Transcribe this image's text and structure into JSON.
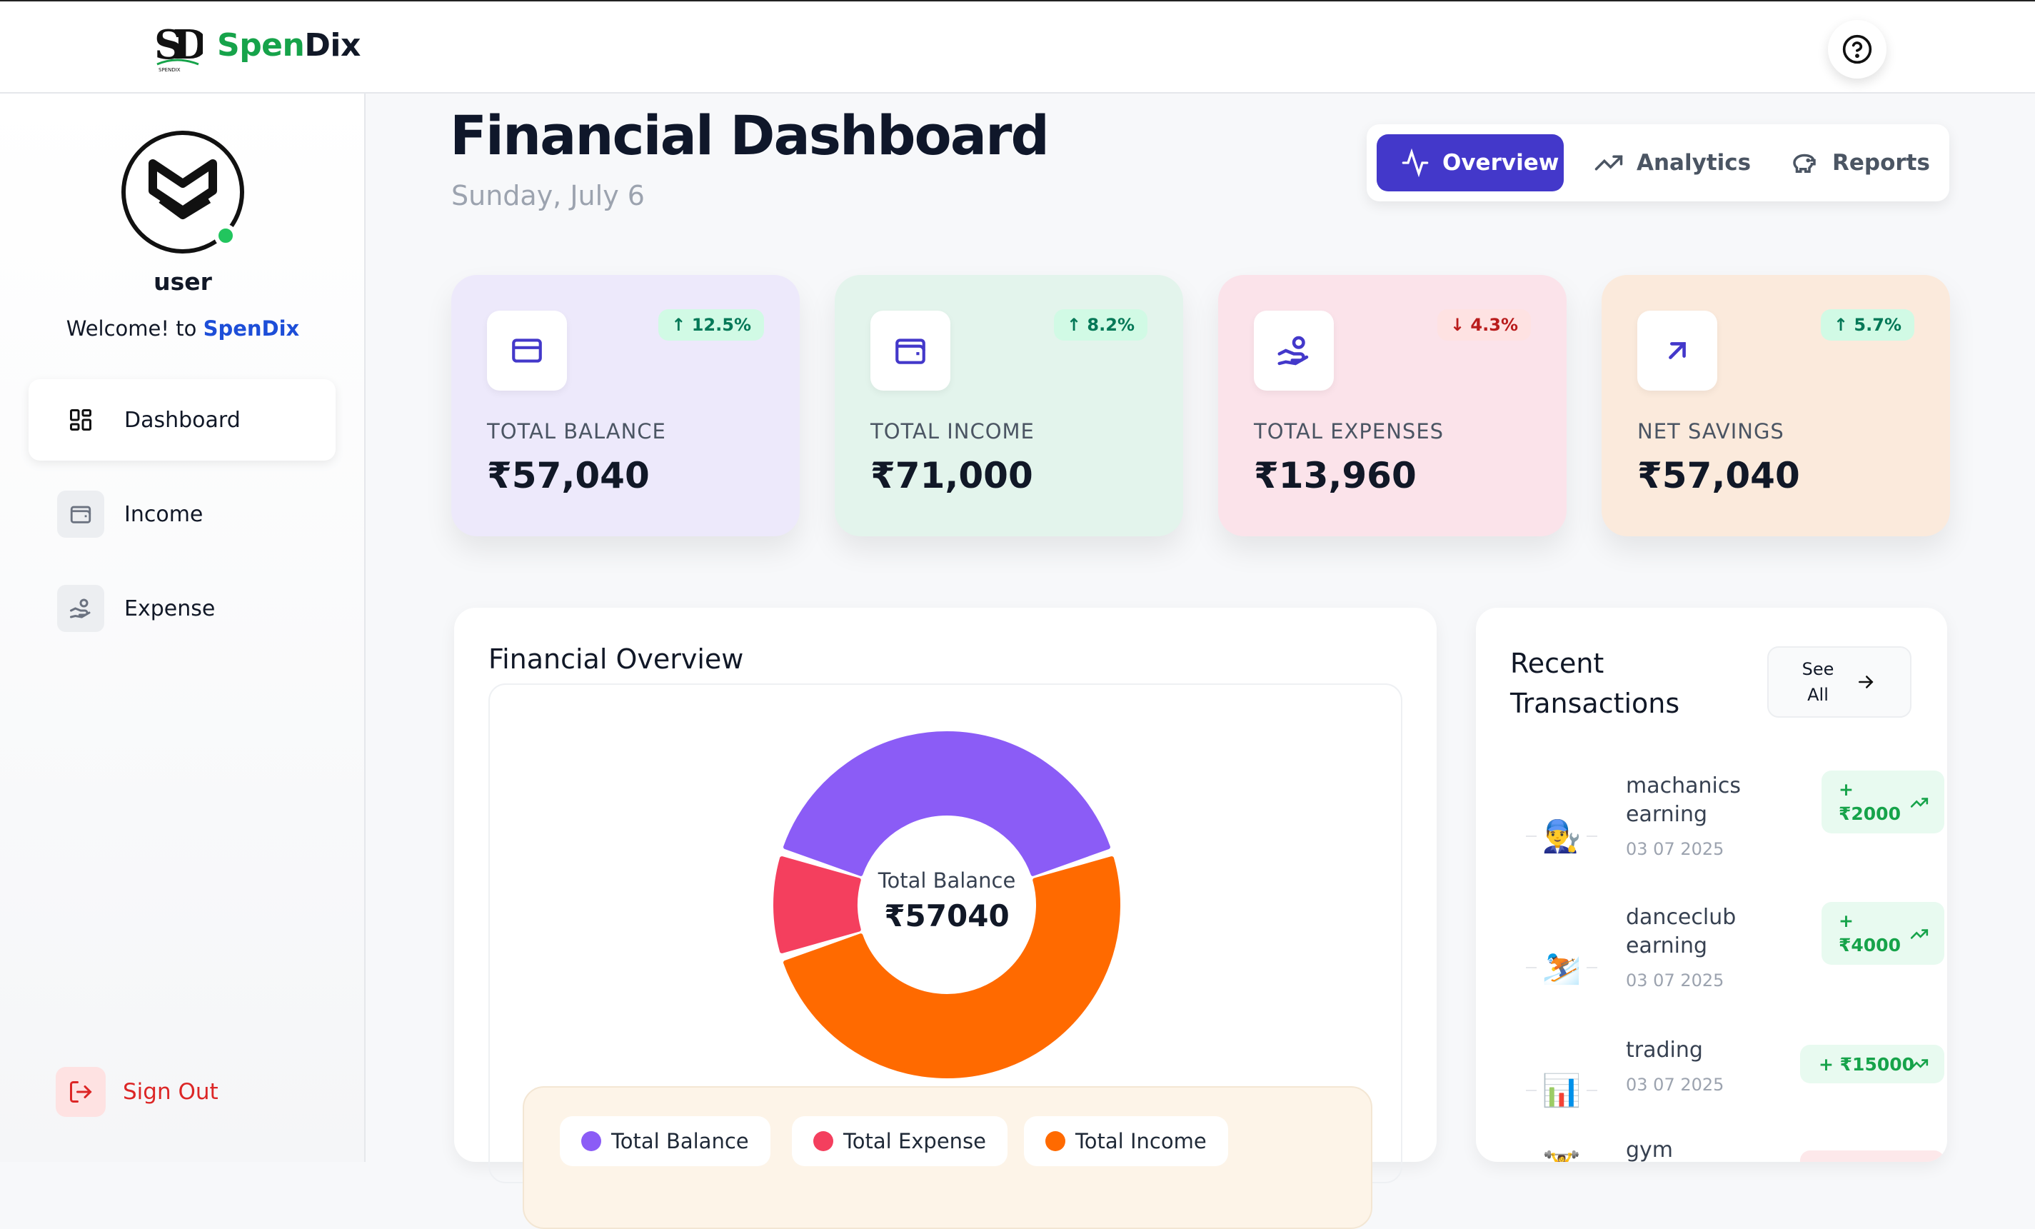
{
  "app": {
    "brand_spen": "Spen",
    "brand_dix": "Dix",
    "logo_sub": "SPENDIX"
  },
  "sidebar": {
    "username": "user",
    "welcome_prefix": "Welcome! to ",
    "welcome_brand": "SpenDix",
    "items": [
      {
        "label": "Dashboard",
        "icon": "grid-icon",
        "active": true
      },
      {
        "label": "Income",
        "icon": "wallet-icon",
        "active": false
      },
      {
        "label": "Expense",
        "icon": "hand-coins-icon",
        "active": false
      }
    ],
    "signout_label": "Sign Out"
  },
  "header": {
    "title": "Financial Dashboard",
    "date": "Sunday, July 6",
    "tabs": [
      {
        "label": "Overview",
        "icon": "activity-icon",
        "active": true
      },
      {
        "label": "Analytics",
        "icon": "trending-up-icon",
        "active": false
      },
      {
        "label": "Reports",
        "icon": "piggy-bank-icon",
        "active": false
      }
    ]
  },
  "cards": [
    {
      "label": "TOTAL BALANCE",
      "value": "₹57,040",
      "change": "↑ 12.5%",
      "trend": "up",
      "bg": "#ede9fb",
      "icon": "credit-card-icon"
    },
    {
      "label": "TOTAL INCOME",
      "value": "₹71,000",
      "change": "↑ 8.2%",
      "trend": "up",
      "bg": "#e3f4ec",
      "icon": "wallet-icon"
    },
    {
      "label": "TOTAL EXPENSES",
      "value": "₹13,960",
      "change": "↓ 4.3%",
      "trend": "down",
      "bg": "#fbe3ea",
      "icon": "hand-coins-icon"
    },
    {
      "label": "NET SAVINGS",
      "value": "₹57,040",
      "change": "↑ 5.7%",
      "trend": "up",
      "bg": "#fbeadc",
      "icon": "arrow-up-right-icon"
    }
  ],
  "overview": {
    "title": "Financial Overview",
    "center_label": "Total Balance",
    "center_value": "₹57040",
    "legend": [
      {
        "label": "Total Balance",
        "color": "#8b5cf6"
      },
      {
        "label": "Total Expense",
        "color": "#f43f5e"
      },
      {
        "label": "Total Income",
        "color": "#ff6a00"
      }
    ]
  },
  "chart_data": {
    "type": "pie",
    "categories": [
      "Total Balance",
      "Total Expense",
      "Total Income"
    ],
    "values": [
      57040,
      13960,
      71000
    ],
    "colors": [
      "#8b5cf6",
      "#f43f5e",
      "#ff6a00"
    ],
    "title": "Financial Overview"
  },
  "transactions": {
    "title": "Recent Transactions",
    "see_all_line1": "See",
    "see_all_line2": "All",
    "items": [
      {
        "name_line1": "machanics",
        "name_line2": "earning",
        "date": "03 07 2025",
        "emoji": "👨‍🔧",
        "amount_sign": "+",
        "amount": "₹2000"
      },
      {
        "name_line1": "danceclub",
        "name_line2": "earning",
        "date": "03 07 2025",
        "emoji": "⛷️",
        "amount_sign": "+",
        "amount": "₹4000"
      },
      {
        "name_line1": "trading",
        "name_line2": "",
        "date": "03 07 2025",
        "emoji": "📊",
        "amount_sign": "+",
        "amount": "+ ₹15000"
      },
      {
        "name_line1": "gym",
        "name_line2": "",
        "date": "",
        "emoji": "🏋️",
        "amount_sign": "",
        "amount": ""
      }
    ]
  }
}
